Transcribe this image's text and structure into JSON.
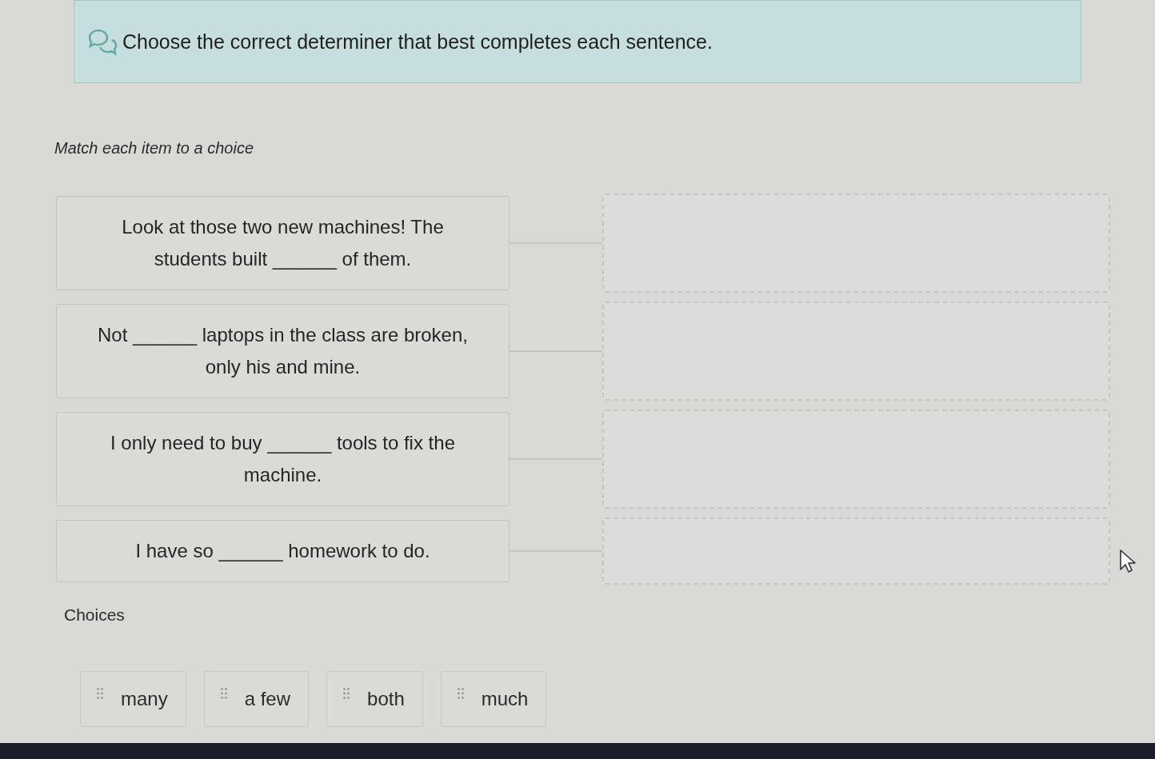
{
  "instruction": {
    "text": "Choose the correct determiner that best completes each sentence."
  },
  "prompt": "Match each item to a choice",
  "items": [
    {
      "text": "Look at those two new machines! The students built ______ of them."
    },
    {
      "text": "Not ______ laptops in the class are broken, only his and mine."
    },
    {
      "text": "I only need to buy ______ tools to fix the machine."
    },
    {
      "text": "I have so ______ homework to do."
    }
  ],
  "choices_label": "Choices",
  "choices": [
    "many",
    "a few",
    "both",
    "much"
  ]
}
